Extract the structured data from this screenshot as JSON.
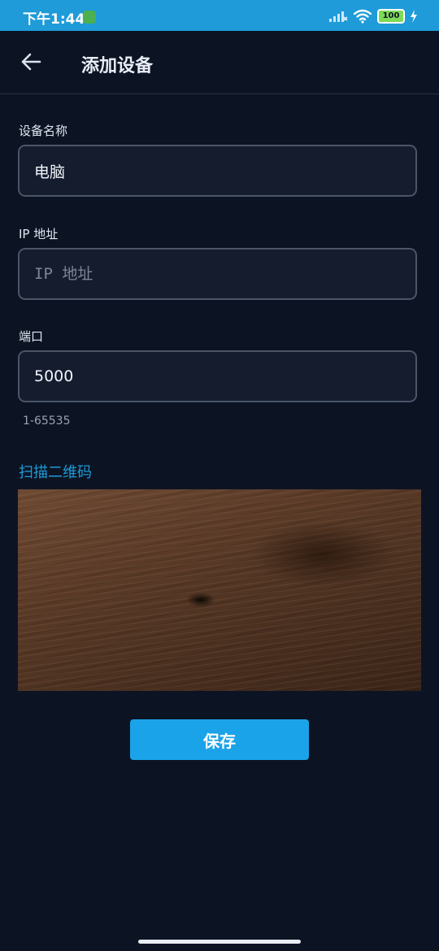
{
  "status_bar": {
    "time": "下午1:44",
    "battery": "100",
    "icons": [
      "signal-icon",
      "wifi-icon",
      "battery-icon",
      "charging-icon"
    ]
  },
  "app_bar": {
    "title": "添加设备",
    "back_icon": "arrow-left-icon"
  },
  "form": {
    "name": {
      "label": "设备名称",
      "value": "电脑",
      "placeholder": ""
    },
    "ip": {
      "label": "IP 地址",
      "value": "",
      "placeholder": "IP 地址"
    },
    "port": {
      "label": "端口",
      "value": "5000",
      "placeholder": "",
      "helper": "1-65535"
    }
  },
  "scan_link": "扫描二维码",
  "save_label": "保存",
  "colors": {
    "accent": "#1e9bd8",
    "background": "#0c1424",
    "field_bg": "#141c2e",
    "field_border": "#4a5566"
  }
}
